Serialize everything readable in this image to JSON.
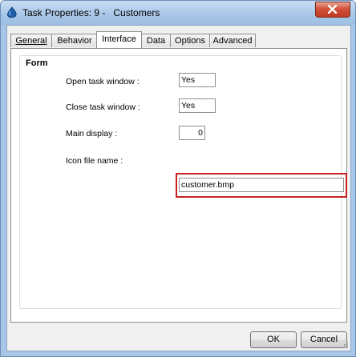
{
  "window": {
    "title": "Task Properties: 9 -   Customers",
    "colors": {
      "frame": "#a9c6e6",
      "close": "#c03a22",
      "highlight": "#cc1f1f"
    }
  },
  "tabs": [
    {
      "label": "General",
      "active": false
    },
    {
      "label": "Behavior",
      "active": false
    },
    {
      "label": "Interface",
      "active": true
    },
    {
      "label": "Data",
      "active": false
    },
    {
      "label": "Options",
      "active": false
    },
    {
      "label": "Advanced",
      "active": false
    }
  ],
  "form": {
    "title": "Form",
    "open_task_window": {
      "label": "Open task window :",
      "value": "Yes"
    },
    "close_task_window": {
      "label": "Close task window :",
      "value": "Yes"
    },
    "main_display": {
      "label": "Main display :",
      "value": "0"
    },
    "icon_file_name": {
      "label": "Icon file name :",
      "value": "customer.bmp"
    }
  },
  "buttons": {
    "ok": "OK",
    "cancel": "Cancel"
  },
  "icons": {
    "app": "app-drop-icon",
    "close": "close-icon",
    "grip": "resize-grip-icon"
  }
}
